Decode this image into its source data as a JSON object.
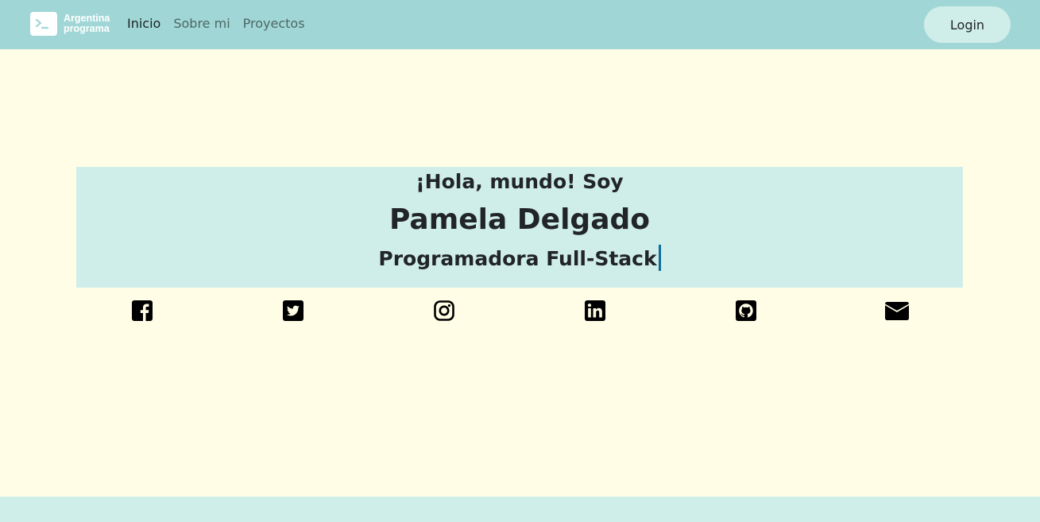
{
  "navbar": {
    "brand": {
      "line1": "Argentina",
      "line2": "programa",
      "icon": "terminal-icon"
    },
    "links": [
      {
        "label": "Inicio",
        "active": true
      },
      {
        "label": "Sobre mi",
        "active": false
      },
      {
        "label": "Proyectos",
        "active": false
      }
    ],
    "login_label": "Login"
  },
  "hero": {
    "greeting": "¡Hola, mundo! Soy",
    "name": "Pamela Delgado",
    "role": "Programadora Full-Stack"
  },
  "social": [
    {
      "icon": "facebook-icon"
    },
    {
      "icon": "twitter-icon"
    },
    {
      "icon": "instagram-icon"
    },
    {
      "icon": "linkedin-icon"
    },
    {
      "icon": "github-icon"
    },
    {
      "icon": "envelope-icon"
    }
  ],
  "colors": {
    "navbar_bg": "#a0d7d6",
    "page_bg": "#fffde6",
    "hero_bg": "#cfede9",
    "cursor": "#0d6e9c"
  }
}
